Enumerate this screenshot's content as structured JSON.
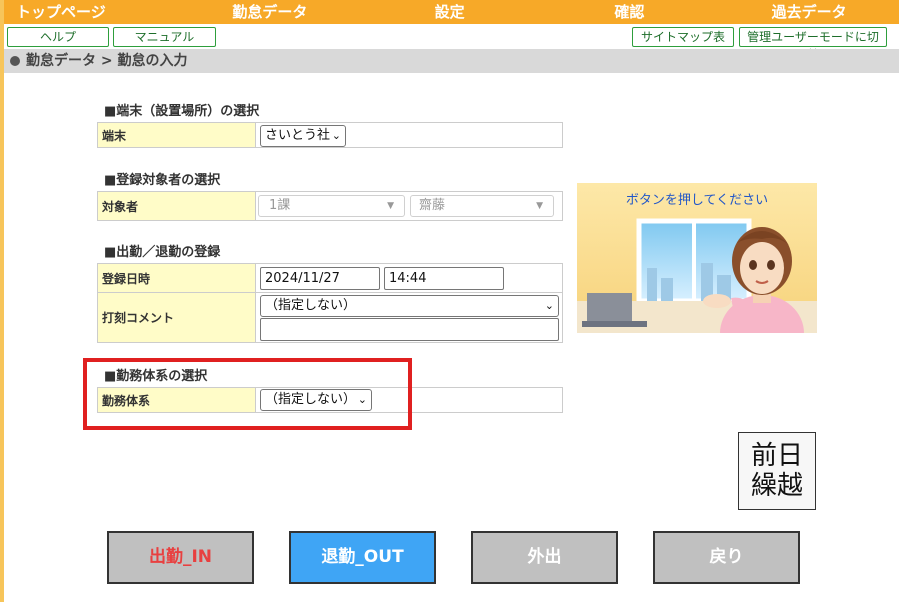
{
  "nav": {
    "items": [
      "トップページ",
      "勤怠データ",
      "設定",
      "確認",
      "過去データ"
    ]
  },
  "subbar": {
    "help": "ヘルプ",
    "manual": "マニュアル",
    "sitemap": "サイトマップ表示",
    "admin_mode": "管理ユーザーモードに切替"
  },
  "breadcrumb": "勤怠データ > 勤怠の入力",
  "terminal": {
    "section_title": "■端末（設置場所）の選択",
    "label": "端末",
    "selected": "さいとう社"
  },
  "target": {
    "section_title": "■登録対象者の選択",
    "label": "対象者",
    "dept": "1課",
    "person": "齋藤"
  },
  "attendance": {
    "section_title": "■出勤／退勤の登録",
    "date_label": "登録日時",
    "date_value": "2024/11/27",
    "time_value": "14:44",
    "comment_label": "打刻コメント",
    "comment_selected": "（指定しない）",
    "comment_text": ""
  },
  "work_system": {
    "section_title": "■勤務体系の選択",
    "label": "勤務体系",
    "selected": "（指定しない）"
  },
  "illustration": {
    "bubble_text": "ボタンを押してください"
  },
  "zenjitsu": {
    "line1": "前日",
    "line2": "繰越"
  },
  "buttons": {
    "in": "出勤_IN",
    "out": "退勤_OUT",
    "gaishutsu": "外出",
    "back": "戻り"
  },
  "colors": {
    "nav_bg": "#f7a928",
    "label_bg": "#fffcc8",
    "out_btn": "#3fa5f5",
    "in_text": "#e84040",
    "gray_btn": "#c0c0c0",
    "highlight": "#e02020"
  }
}
